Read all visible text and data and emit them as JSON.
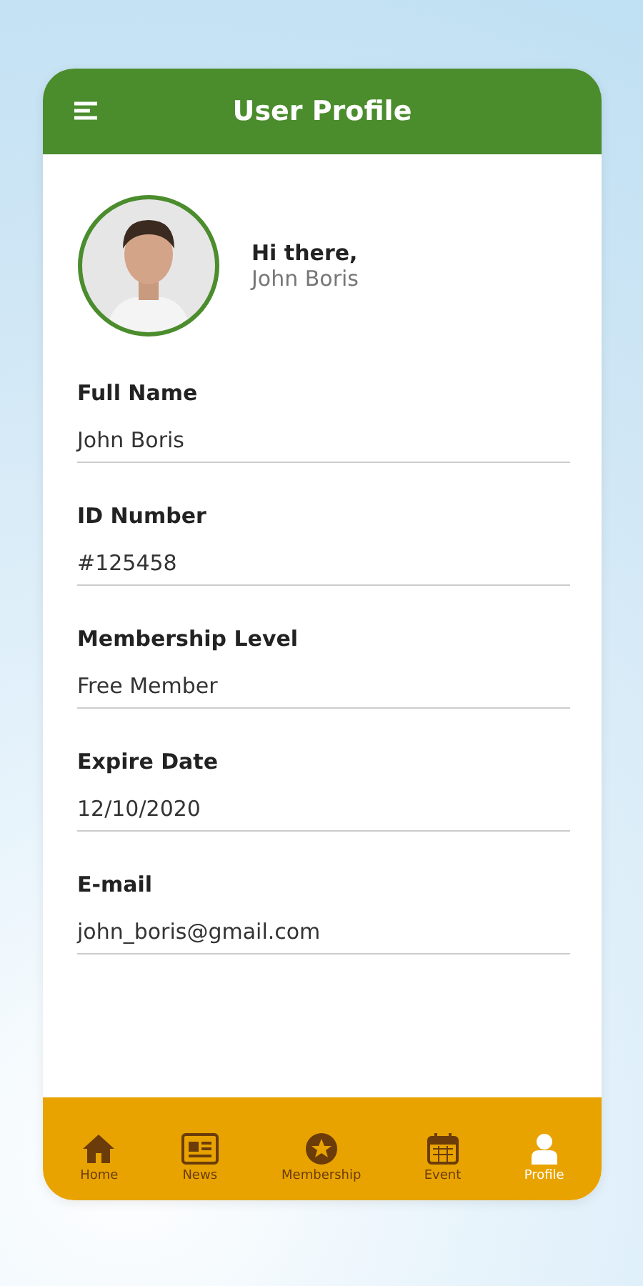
{
  "header": {
    "title": "User Profile"
  },
  "greeting": {
    "hello": "Hi there,",
    "name": "John Boris"
  },
  "fields": [
    {
      "label": "Full Name",
      "value": "John Boris"
    },
    {
      "label": "ID Number",
      "value": "#125458"
    },
    {
      "label": "Membership Level",
      "value": "Free Member"
    },
    {
      "label": "Expire Date",
      "value": "12/10/2020"
    },
    {
      "label": "E-mail",
      "value": "john_boris@gmail.com"
    }
  ],
  "nav": [
    {
      "kind": "home",
      "label": "Home",
      "selected": false
    },
    {
      "kind": "news",
      "label": "News",
      "selected": false
    },
    {
      "kind": "membership",
      "label": "Membership",
      "selected": false
    },
    {
      "kind": "event",
      "label": "Event",
      "selected": false
    },
    {
      "kind": "profile",
      "label": "Profile",
      "selected": true
    }
  ]
}
